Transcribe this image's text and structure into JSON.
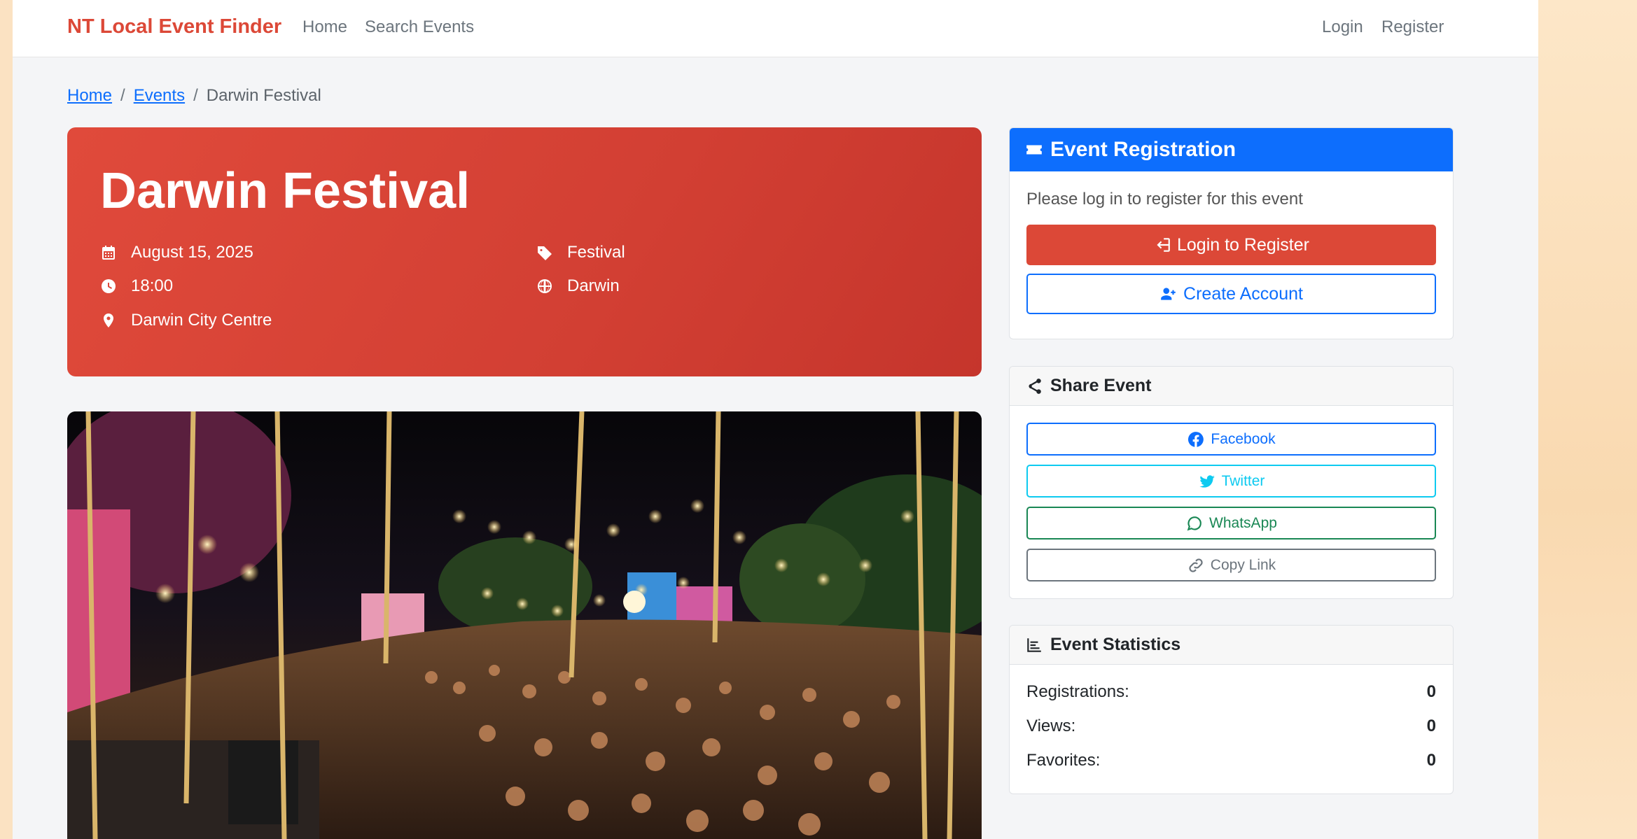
{
  "navbar": {
    "brand": "NT Local Event Finder",
    "links": [
      "Home",
      "Search Events"
    ],
    "login": "Login",
    "register": "Register"
  },
  "breadcrumb": {
    "home": "Home",
    "events": "Events",
    "current": "Darwin Festival"
  },
  "event": {
    "title": "Darwin Festival",
    "date": "August 15, 2025",
    "time": "18:00",
    "location": "Darwin City Centre",
    "category": "Festival",
    "region": "Darwin"
  },
  "registration": {
    "header": "Event Registration",
    "message": "Please log in to register for this event",
    "login_button": "Login to Register",
    "create_button": "Create Account"
  },
  "share": {
    "header": "Share Event",
    "facebook": "Facebook",
    "twitter": "Twitter",
    "whatsapp": "WhatsApp",
    "copy": "Copy Link"
  },
  "stats": {
    "header": "Event Statistics",
    "rows": [
      {
        "label": "Registrations:",
        "value": "0"
      },
      {
        "label": "Views:",
        "value": "0"
      },
      {
        "label": "Favorites:",
        "value": "0"
      }
    ]
  },
  "colors": {
    "brand": "#dc4837",
    "primary": "#0d6efd",
    "hero": "#d23f33"
  }
}
